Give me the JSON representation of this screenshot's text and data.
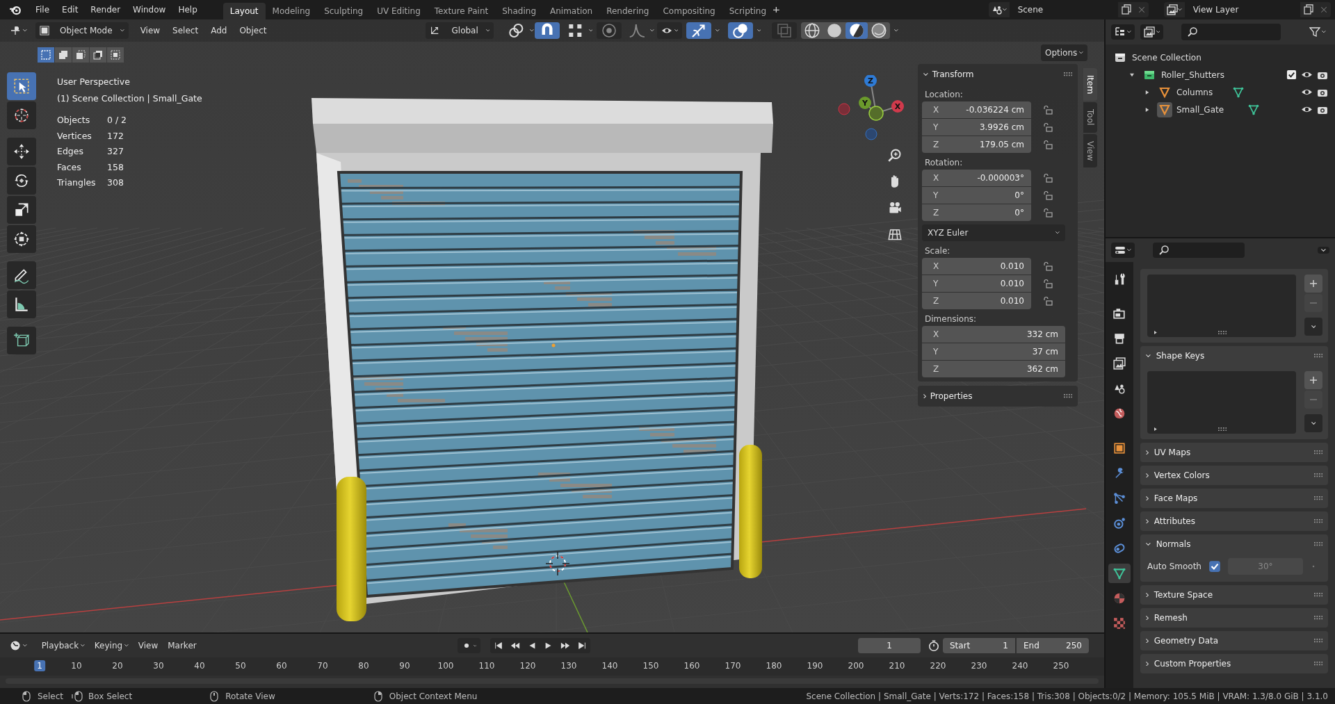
{
  "menu": [
    "File",
    "Edit",
    "Render",
    "Window",
    "Help"
  ],
  "workspaces": [
    {
      "label": "Layout",
      "selected": true
    },
    {
      "label": "Modeling",
      "selected": false
    },
    {
      "label": "Sculpting",
      "selected": false
    },
    {
      "label": "UV Editing",
      "selected": false
    },
    {
      "label": "Texture Paint",
      "selected": false
    },
    {
      "label": "Shading",
      "selected": false
    },
    {
      "label": "Animation",
      "selected": false
    },
    {
      "label": "Rendering",
      "selected": false
    },
    {
      "label": "Compositing",
      "selected": false
    },
    {
      "label": "Scripting",
      "selected": false
    }
  ],
  "scene": "Scene",
  "view_layer": "View Layer",
  "viewport": {
    "mode": "Object Mode",
    "toggles": {
      "snap": true,
      "proportional": false,
      "gizmos": true,
      "overlays": true,
      "xray": false
    },
    "menus": [
      "View",
      "Select",
      "Add",
      "Object"
    ],
    "orientation": "Global",
    "options": "Options",
    "select_modes": [
      {
        "kind": "set",
        "selected": true
      },
      {
        "kind": "extend",
        "selected": false
      },
      {
        "kind": "subtract",
        "selected": false
      },
      {
        "kind": "difference",
        "selected": false
      },
      {
        "kind": "intersect",
        "selected": false
      }
    ],
    "shading": [
      {
        "kind": "wireframe",
        "selected": false
      },
      {
        "kind": "solid",
        "selected": false
      },
      {
        "kind": "material",
        "selected": true
      },
      {
        "kind": "rendered",
        "selected": false
      }
    ],
    "title": "User Perspective",
    "subtitle": "(1) Scene Collection | Small_Gate",
    "stats": [
      {
        "label": "Objects",
        "value": "0 / 2"
      },
      {
        "label": "Vertices",
        "value": "172"
      },
      {
        "label": "Edges",
        "value": "327"
      },
      {
        "label": "Faces",
        "value": "158"
      },
      {
        "label": "Triangles",
        "value": "308"
      }
    ],
    "tools": [
      {
        "kind": "select-box",
        "selected": true
      },
      {
        "kind": "cursor",
        "selected": false
      },
      {
        "kind": "move",
        "selected": false
      },
      {
        "kind": "rotate",
        "selected": false
      },
      {
        "kind": "scale",
        "selected": false
      },
      {
        "kind": "transform",
        "selected": false
      },
      {
        "kind": "annotate",
        "selected": false
      },
      {
        "kind": "measure",
        "selected": false
      },
      {
        "kind": "add-cube",
        "selected": false
      }
    ],
    "gizmo": {
      "x": "X",
      "y": "Y",
      "z": "Z"
    }
  },
  "sidebar": {
    "tabs": [
      {
        "label": "Item",
        "selected": true
      },
      {
        "label": "Tool",
        "selected": false
      },
      {
        "label": "View",
        "selected": false
      }
    ],
    "transform": {
      "title": "Transform",
      "expanded": true,
      "rows": [
        {
          "kind": "vector",
          "label": "Location:",
          "fields": [
            {
              "axis": "X",
              "value": "-0.036224 cm",
              "locked": false
            },
            {
              "axis": "Y",
              "value": "3.9926 cm",
              "locked": false
            },
            {
              "axis": "Z",
              "value": "179.05 cm",
              "locked": false
            }
          ]
        },
        {
          "kind": "vector",
          "label": "Rotation:",
          "fields": [
            {
              "axis": "X",
              "value": "-0.000003°",
              "locked": false
            },
            {
              "axis": "Y",
              "value": "0°",
              "locked": false
            },
            {
              "axis": "Z",
              "value": "0°",
              "locked": false
            }
          ]
        },
        {
          "kind": "dropdown",
          "value": "XYZ Euler"
        },
        {
          "kind": "vector",
          "label": "Scale:",
          "fields": [
            {
              "axis": "X",
              "value": "0.010",
              "locked": false
            },
            {
              "axis": "Y",
              "value": "0.010",
              "locked": false
            },
            {
              "axis": "Z",
              "value": "0.010",
              "locked": false
            }
          ]
        },
        {
          "kind": "vector",
          "label": "Dimensions:",
          "fields": [
            {
              "axis": "X",
              "value": "332 cm"
            },
            {
              "axis": "Y",
              "value": "37 cm"
            },
            {
              "axis": "Z",
              "value": "362 cm"
            }
          ]
        }
      ]
    },
    "properties": {
      "title": "Properties",
      "expanded": false
    }
  },
  "outliner": {
    "items": [
      {
        "label": "Scene Collection",
        "kind": "scene-collection",
        "children": [
          {
            "label": "Roller_Shutters",
            "kind": "collection",
            "expanded": true,
            "checked": true,
            "children": [
              {
                "label": "Columns",
                "kind": "mesh-object",
                "expanded": false,
                "active": false
              },
              {
                "label": "Small_Gate",
                "kind": "mesh-object",
                "expanded": false,
                "active": true
              }
            ]
          }
        ]
      }
    ]
  },
  "properties": {
    "tabs": [
      {
        "kind": "tool",
        "selected": false
      },
      {
        "kind": "render",
        "selected": false
      },
      {
        "kind": "output",
        "selected": false
      },
      {
        "kind": "view-layer",
        "selected": false
      },
      {
        "kind": "scene",
        "selected": false
      },
      {
        "kind": "world",
        "selected": false
      },
      {
        "kind": "object",
        "selected": false
      },
      {
        "kind": "modifier",
        "selected": false
      },
      {
        "kind": "particles",
        "selected": false
      },
      {
        "kind": "physics",
        "selected": false
      },
      {
        "kind": "constraints",
        "selected": false
      },
      {
        "kind": "data",
        "selected": true
      },
      {
        "kind": "material",
        "selected": false
      },
      {
        "kind": "texture",
        "selected": false
      }
    ],
    "panels": [
      {
        "kind": "list"
      },
      {
        "kind": "list",
        "title": "Shape Keys",
        "expanded": true
      },
      {
        "title": "UV Maps",
        "expanded": false
      },
      {
        "title": "Vertex Colors",
        "expanded": false
      },
      {
        "title": "Face Maps",
        "expanded": false
      },
      {
        "title": "Attributes",
        "expanded": false
      },
      {
        "kind": "normals",
        "title": "Normals",
        "expanded": true,
        "auto_smooth": {
          "label": "Auto Smooth",
          "checked": true,
          "angle": "30°"
        }
      },
      {
        "title": "Texture Space",
        "expanded": false
      },
      {
        "title": "Remesh",
        "expanded": false
      },
      {
        "title": "Geometry Data",
        "expanded": false
      },
      {
        "title": "Custom Properties",
        "expanded": false
      }
    ]
  },
  "timeline": {
    "menus": [
      {
        "label": "Playback",
        "dropdown": true
      },
      {
        "label": "Keying",
        "dropdown": true
      },
      {
        "label": "View",
        "dropdown": false
      },
      {
        "label": "Marker",
        "dropdown": false
      }
    ],
    "current_frame": "1",
    "start_label": "Start",
    "start": "1",
    "end_label": "End",
    "end": "250",
    "ticks": [
      {
        "label": "1",
        "selected": true
      },
      {
        "label": "10",
        "selected": false
      },
      {
        "label": "20",
        "selected": false
      },
      {
        "label": "30",
        "selected": false
      },
      {
        "label": "40",
        "selected": false
      },
      {
        "label": "50",
        "selected": false
      },
      {
        "label": "60",
        "selected": false
      },
      {
        "label": "70",
        "selected": false
      },
      {
        "label": "80",
        "selected": false
      },
      {
        "label": "90",
        "selected": false
      },
      {
        "label": "100",
        "selected": false
      },
      {
        "label": "110",
        "selected": false
      },
      {
        "label": "120",
        "selected": false
      },
      {
        "label": "130",
        "selected": false
      },
      {
        "label": "140",
        "selected": false
      },
      {
        "label": "150",
        "selected": false
      },
      {
        "label": "160",
        "selected": false
      },
      {
        "label": "170",
        "selected": false
      },
      {
        "label": "180",
        "selected": false
      },
      {
        "label": "190",
        "selected": false
      },
      {
        "label": "200",
        "selected": false
      },
      {
        "label": "210",
        "selected": false
      },
      {
        "label": "220",
        "selected": false
      },
      {
        "label": "230",
        "selected": false
      },
      {
        "label": "240",
        "selected": false
      },
      {
        "label": "250",
        "selected": false
      }
    ]
  },
  "status": {
    "hints": [
      {
        "kind": "left-click",
        "label": "Select"
      },
      {
        "kind": "drag",
        "label": "Box Select"
      },
      {
        "kind": "middle-click",
        "label": "Rotate View"
      },
      {
        "kind": "right-click",
        "label": "Object Context Menu"
      }
    ],
    "info": "Scene Collection | Small_Gate | Verts:172 | Faces:158 | Tris:308 | Objects:0/2 | Memory: 105.5 MiB | VRAM: 1.3/8.0 GiB | 3.1.0"
  }
}
